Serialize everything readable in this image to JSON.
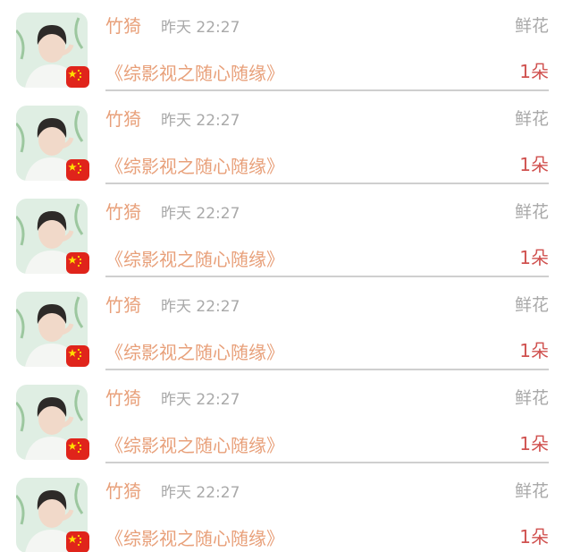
{
  "colors": {
    "name": "#e8a07a",
    "book_title": "#e8a07a",
    "meta_gray": "#a9a9a9",
    "count": "#d0514f",
    "divider": "#cfcfcf",
    "flag_red": "#e0241b",
    "flag_star": "#ffde00"
  },
  "entries": [
    {
      "name": "竹猗",
      "time": "昨天 22:27",
      "gift": "鲜花",
      "book": "《综影视之随心随缘》",
      "count": "1朵",
      "avatar_icon": "user-avatar-icon",
      "badge_icon": "china-flag-icon"
    },
    {
      "name": "竹猗",
      "time": "昨天 22:27",
      "gift": "鲜花",
      "book": "《综影视之随心随缘》",
      "count": "1朵",
      "avatar_icon": "user-avatar-icon",
      "badge_icon": "china-flag-icon"
    },
    {
      "name": "竹猗",
      "time": "昨天 22:27",
      "gift": "鲜花",
      "book": "《综影视之随心随缘》",
      "count": "1朵",
      "avatar_icon": "user-avatar-icon",
      "badge_icon": "china-flag-icon"
    },
    {
      "name": "竹猗",
      "time": "昨天 22:27",
      "gift": "鲜花",
      "book": "《综影视之随心随缘》",
      "count": "1朵",
      "avatar_icon": "user-avatar-icon",
      "badge_icon": "china-flag-icon"
    },
    {
      "name": "竹猗",
      "time": "昨天 22:27",
      "gift": "鲜花",
      "book": "《综影视之随心随缘》",
      "count": "1朵",
      "avatar_icon": "user-avatar-icon",
      "badge_icon": "china-flag-icon"
    },
    {
      "name": "竹猗",
      "time": "昨天 22:27",
      "gift": "鲜花",
      "book": "《综影视之随心随缘》",
      "count": "1朵",
      "avatar_icon": "user-avatar-icon",
      "badge_icon": "china-flag-icon"
    }
  ]
}
